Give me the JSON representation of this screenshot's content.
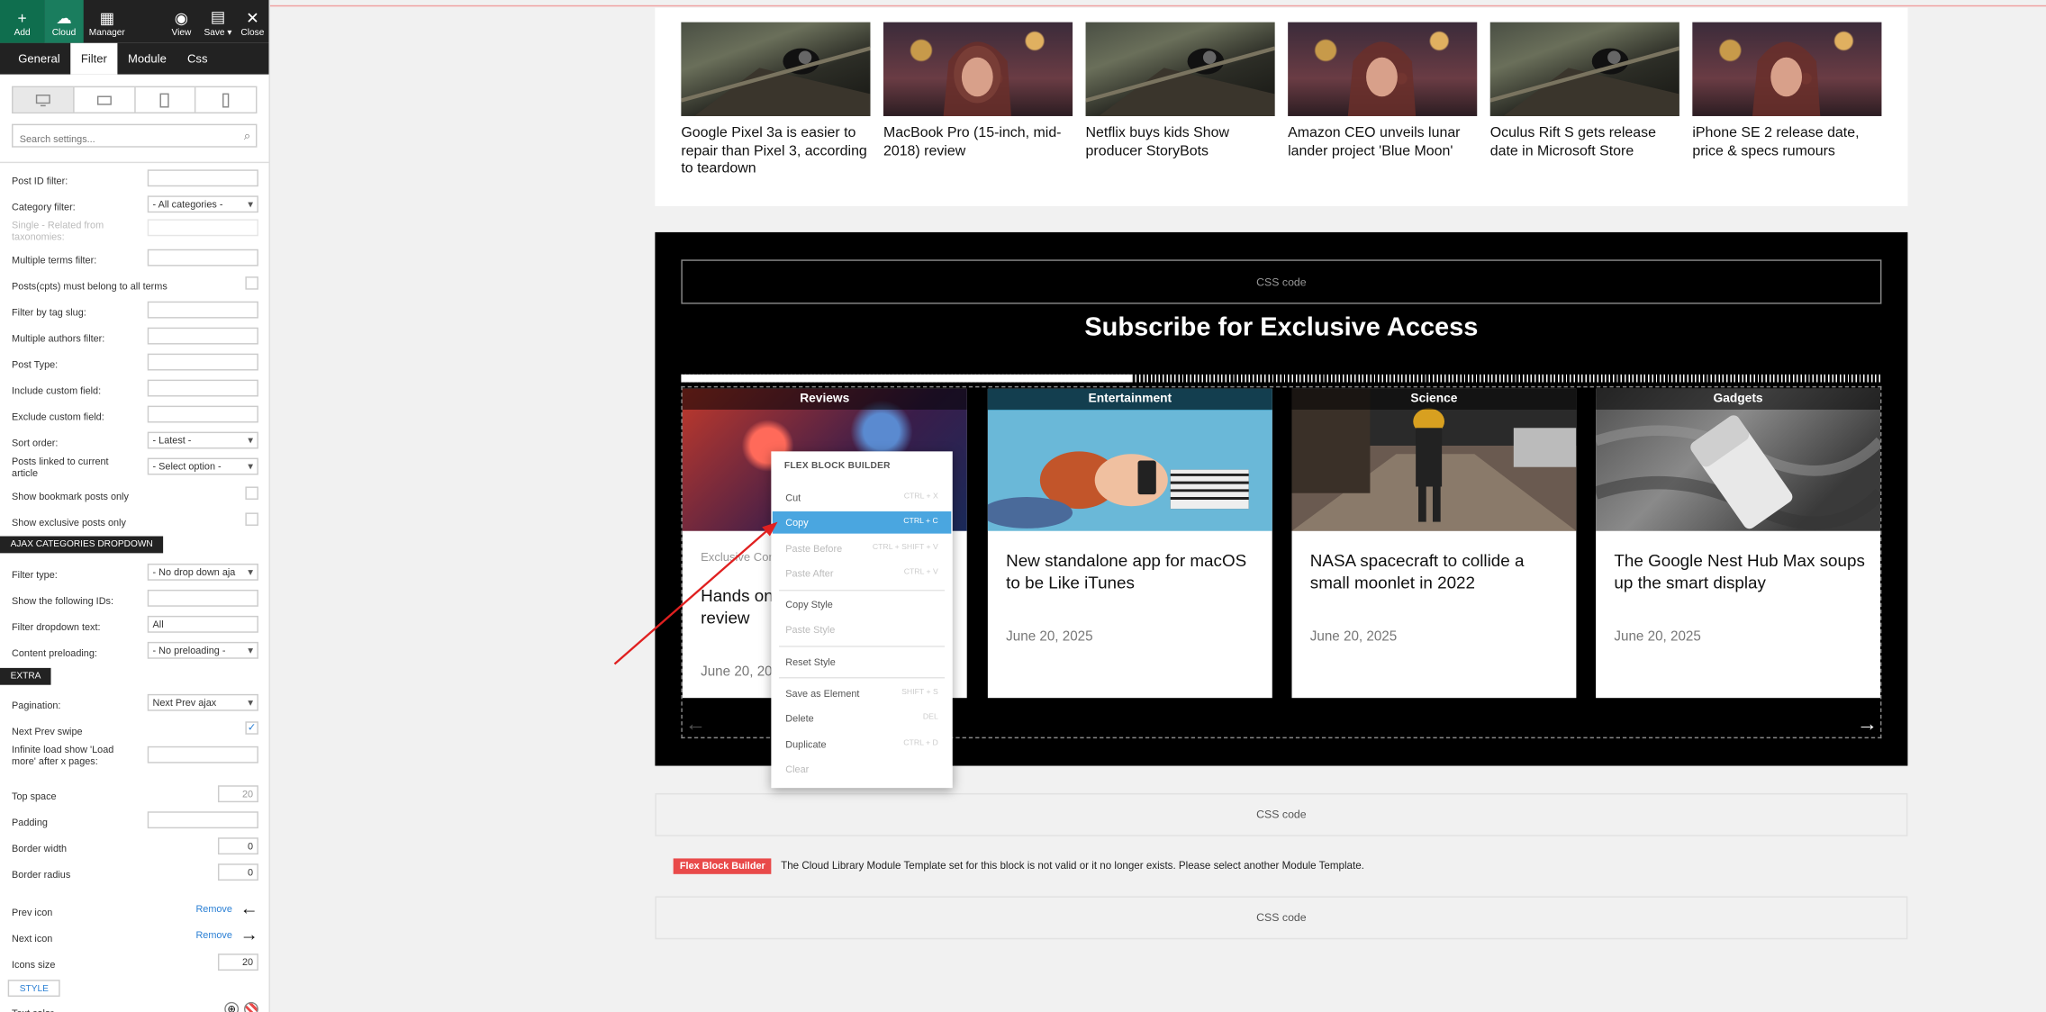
{
  "topbar": {
    "buttons": [
      {
        "label": "Add",
        "icon": "+"
      },
      {
        "label": "Cloud",
        "icon": "☁"
      },
      {
        "label": "Manager",
        "icon": "▦"
      },
      {
        "label": "View",
        "icon": "◉"
      },
      {
        "label": "Save ▾",
        "icon": "▤"
      },
      {
        "label": "Close",
        "icon": "✕"
      }
    ]
  },
  "tabs": [
    "General",
    "Filter",
    "Module",
    "Css"
  ],
  "search_placeholder": "Search settings...",
  "settings": {
    "post_id": "Post ID filter:",
    "category": "Category filter:",
    "category_value": "- All categories -",
    "single_related": "Single - Related from taxonomies:",
    "multiple_terms": "Multiple terms filter:",
    "posts_all_terms": "Posts(cpts) must belong to all terms",
    "tag_slug": "Filter by tag slug:",
    "authors": "Multiple authors filter:",
    "post_type": "Post Type:",
    "include_cf": "Include custom field:",
    "exclude_cf": "Exclude custom field:",
    "sort_order": "Sort order:",
    "sort_order_value": "- Latest -",
    "linked": "Posts linked to current article",
    "linked_value": "- Select option -",
    "bookmark": "Show bookmark posts only",
    "exclusive": "Show exclusive posts only",
    "ajax_section": "AJAX CATEGORIES DROPDOWN",
    "filter_type": "Filter type:",
    "filter_type_value": "- No drop down aja",
    "show_ids": "Show the following IDs:",
    "dropdown_text": "Filter dropdown text:",
    "dropdown_text_value": "All",
    "preloading": "Content preloading:",
    "preloading_value": "- No preloading -",
    "extra_section": "EXTRA",
    "pagination": "Pagination:",
    "pagination_value": "Next Prev ajax",
    "swipe": "Next Prev swipe",
    "infinite": "Infinite load show 'Load more' after x pages:",
    "top_space": "Top space",
    "top_space_value": "20",
    "padding": "Padding",
    "border_width": "Border width",
    "border_width_value": "0",
    "border_radius": "Border radius",
    "border_radius_value": "0",
    "prev_icon": "Prev icon",
    "next_icon": "Next icon",
    "remove": "Remove",
    "icons_size": "Icons size",
    "icons_size_value": "20",
    "style_section": "STYLE",
    "text_color": "Text color"
  },
  "articles": [
    "Google Pixel 3a is easier to repair than Pixel 3, according to teardown",
    "MacBook Pro (15-inch, mid-2018) review",
    "Netflix buys kids Show producer StoryBots",
    "Amazon CEO unveils lunar lander project 'Blue Moon'",
    "Oculus Rift S gets release date in Microsoft Store",
    "iPhone SE 2 release date, price & specs rumours"
  ],
  "css_code_label": "CSS code",
  "subscribe_title": "Subscribe for Exclusive Access",
  "carousel_progress": 0.376,
  "cards": [
    {
      "category": "Reviews",
      "title": "Hands on Apple MacBook Pro review",
      "date": "June 20, 2025",
      "exclusive": "Exclusive Content"
    },
    {
      "category": "Entertainment",
      "title": "New standalone app for macOS to be Like iTunes",
      "date": "June 20, 2025"
    },
    {
      "category": "Science",
      "title": "NASA spacecraft to collide a small moonlet in 2022",
      "date": "June 20, 2025"
    },
    {
      "category": "Gadgets",
      "title": "The Google Nest Hub Max soups up the smart display",
      "date": "June 20, 2025"
    }
  ],
  "fbb_tag": "Flex Block Builder",
  "fbb_message": "The Cloud Library Module Template set for this block is not valid or it no longer exists. Please select another Module Template.",
  "context_menu": {
    "title": "FLEX BLOCK BUILDER",
    "items": [
      {
        "label": "Cut",
        "shortcut": "CTRL + X"
      },
      {
        "label": "Copy",
        "shortcut": "CTRL + C"
      },
      {
        "label": "Paste Before",
        "shortcut": "CTRL + SHIFT + V"
      },
      {
        "label": "Paste After",
        "shortcut": "CTRL + V"
      },
      {
        "label": "Copy Style",
        "shortcut": ""
      },
      {
        "label": "Paste Style",
        "shortcut": ""
      },
      {
        "label": "Reset Style",
        "shortcut": ""
      },
      {
        "label": "Save as Element",
        "shortcut": "SHIFT + S"
      },
      {
        "label": "Delete",
        "shortcut": "DEL"
      },
      {
        "label": "Duplicate",
        "shortcut": "CTRL + D"
      },
      {
        "label": "Clear",
        "shortcut": ""
      }
    ]
  },
  "colors": {
    "accent": "#4aa6e0",
    "toolbar": "#222222",
    "add": "#0f6e4e",
    "cloud": "#1a7d5e",
    "error_tag": "#e94a4a"
  }
}
